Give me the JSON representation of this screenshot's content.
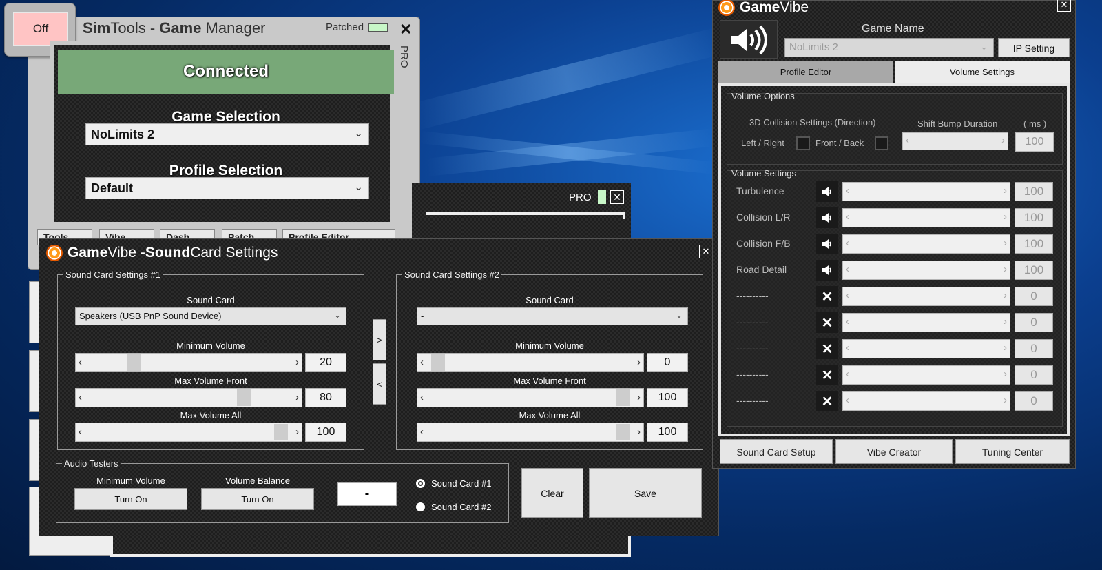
{
  "game_manager": {
    "off_label": "Off",
    "title_parts": [
      "Sim",
      "Tools - ",
      "Game",
      " Manager"
    ],
    "patched_label": "Patched",
    "close_glyph": "✕",
    "pro_label": "PRO",
    "status": "Connected",
    "game_selection_label": "Game Selection",
    "game_selection_value": "NoLimits 2",
    "profile_selection_label": "Profile Selection",
    "profile_selection_value": "Default",
    "tabs": [
      "Tools",
      "Vibe",
      "Dash",
      "Patch",
      "Profile Editor"
    ],
    "status_color": "#78a878",
    "off_color": "#ffc4c4"
  },
  "background_window": {
    "pro_label": "PRO",
    "close_glyph": "✕"
  },
  "sound_card_settings": {
    "title_parts": [
      "Game",
      " Vibe - ",
      "Sound",
      " Card Settings"
    ],
    "close_glyph": "✕",
    "group1": {
      "legend": "Sound Card Settings #1",
      "sound_card_label": "Sound Card",
      "sound_card_value": "Speakers (USB PnP Sound Device)",
      "min_volume_label": "Minimum Volume",
      "min_volume_value": "20",
      "min_volume_fraction": 0.2,
      "max_front_label": "Max Volume Front",
      "max_front_value": "80",
      "max_front_fraction": 0.8,
      "max_all_label": "Max Volume All",
      "max_all_value": "100",
      "max_all_fraction": 1.0
    },
    "copy_right_label": ">",
    "copy_left_label": "<",
    "group2": {
      "legend": "Sound Card Settings #2",
      "sound_card_label": "Sound Card",
      "sound_card_value": "-",
      "min_volume_label": "Minimum Volume",
      "min_volume_value": "0",
      "min_volume_fraction": 0.0,
      "max_front_label": "Max Volume Front",
      "max_front_value": "100",
      "max_front_fraction": 1.0,
      "max_all_label": "Max Volume All",
      "max_all_value": "100",
      "max_all_fraction": 1.0
    },
    "audio_testers": {
      "legend": "Audio Testers",
      "min_volume_label": "Minimum Volume",
      "min_volume_button": "Turn On",
      "balance_label": "Volume Balance",
      "balance_button": "Turn On",
      "readout": "-",
      "radio1_label": "Sound Card #1",
      "radio2_label": "Sound Card #2",
      "selected_radio": 1
    },
    "clear_label": "Clear",
    "save_label": "Save"
  },
  "game_vibe": {
    "title_parts": [
      "Game",
      " Vibe"
    ],
    "close_glyph": "✕",
    "speaker_icon": "speaker-volume-icon",
    "game_name_label": "Game Name",
    "game_name_value": "NoLimits 2",
    "ip_setting_label": "IP Setting",
    "tabs": [
      "Profile Editor",
      "Volume Settings"
    ],
    "active_tab": 1,
    "volume_options": {
      "legend": "Volume Options",
      "collision_label": "3D Collision Settings (Direction)",
      "left_right_label": "Left / Right",
      "front_back_label": "Front / Back",
      "shift_bump_label": "Shift Bump Duration",
      "ms_label": "( ms )",
      "shift_bump_value": "100"
    },
    "volume_settings": {
      "legend": "Volume Settings",
      "rows": [
        {
          "name": "Turbulence",
          "icon": "speaker-icon",
          "value": "100"
        },
        {
          "name": "Collision L/R",
          "icon": "speaker-icon",
          "value": "100"
        },
        {
          "name": "Collision F/B",
          "icon": "speaker-icon",
          "value": "100"
        },
        {
          "name": "Road Detail",
          "icon": "speaker-icon",
          "value": "100"
        },
        {
          "name": "----------",
          "icon": "x-icon",
          "value": "0"
        },
        {
          "name": "----------",
          "icon": "x-icon",
          "value": "0"
        },
        {
          "name": "----------",
          "icon": "x-icon",
          "value": "0"
        },
        {
          "name": "----------",
          "icon": "x-icon",
          "value": "0"
        },
        {
          "name": "----------",
          "icon": "x-icon",
          "value": "0"
        }
      ]
    },
    "bottom_buttons": [
      "Sound Card Setup",
      "Vibe Creator",
      "Tuning Center"
    ]
  }
}
